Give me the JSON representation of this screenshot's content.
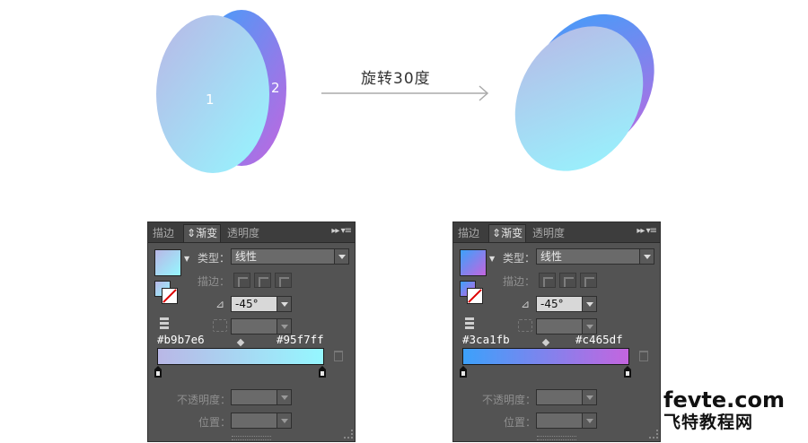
{
  "illustration": {
    "label_front": "1",
    "label_back": "2",
    "arrow_label": "旋转30度"
  },
  "colors": {
    "front_top": "#b9b7e6",
    "front_bottom": "#95f7ff",
    "back_top": "#3ca1fb",
    "back_bottom": "#c465df",
    "panel_bg": "#535353"
  },
  "panel_left": {
    "tabs": [
      "描边",
      "渐变",
      "透明度"
    ],
    "active_tab": "渐变",
    "active_tab_icon": "⇕",
    "menu_icon": "▸▸ ▾≡",
    "type_label": "类型：",
    "type_value": "线性",
    "stroke_label": "描边：",
    "angle_value": "-45°",
    "aspect_value": "",
    "stop_left_hex": "#b9b7e6",
    "stop_right_hex": "#95f7ff",
    "opacity_label": "不透明度：",
    "location_label": "位置："
  },
  "panel_right": {
    "tabs": [
      "描边",
      "渐变",
      "透明度"
    ],
    "active_tab": "渐变",
    "active_tab_icon": "⇕",
    "menu_icon": "▸▸ ▾≡",
    "type_label": "类型：",
    "type_value": "线性",
    "stroke_label": "描边：",
    "angle_value": "-45°",
    "aspect_value": "",
    "stop_left_hex": "#3ca1fb",
    "stop_right_hex": "#c465df",
    "opacity_label": "不透明度：",
    "location_label": "位置："
  },
  "watermark": {
    "line1": "fevte.com",
    "line2": "飞特教程网"
  }
}
